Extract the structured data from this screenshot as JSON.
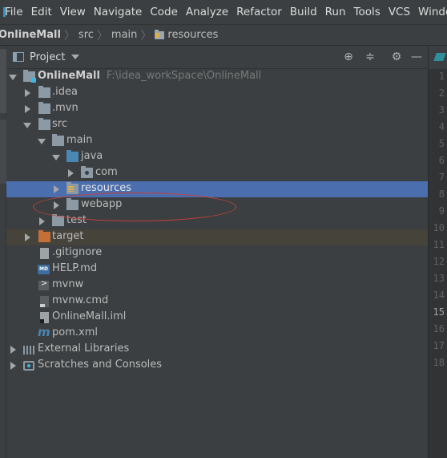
{
  "menubar": {
    "items": [
      "File",
      "Edit",
      "View",
      "Navigate",
      "Code",
      "Analyze",
      "Refactor",
      "Build",
      "Run",
      "Tools",
      "VCS",
      "Window"
    ]
  },
  "breadcrumb": {
    "project": "OnlineMall",
    "parts": [
      "src",
      "main",
      "resources"
    ]
  },
  "project_panel": {
    "title": "Project",
    "tree": [
      {
        "label": "OnlineMall",
        "path": "F:\\idea_workSpace\\OnlineMall"
      },
      {
        "label": ".idea"
      },
      {
        "label": ".mvn"
      },
      {
        "label": "src"
      },
      {
        "label": "main"
      },
      {
        "label": "java"
      },
      {
        "label": "com"
      },
      {
        "label": "resources"
      },
      {
        "label": "webapp"
      },
      {
        "label": "test"
      },
      {
        "label": "target"
      },
      {
        "label": ".gitignore"
      },
      {
        "label": "HELP.md"
      },
      {
        "label": "mvnw"
      },
      {
        "label": "mvnw.cmd"
      },
      {
        "label": "OnlineMall.iml"
      },
      {
        "label": "pom.xml"
      },
      {
        "label": "External Libraries"
      },
      {
        "label": "Scratches and Consoles"
      }
    ]
  },
  "editor": {
    "line_numbers": [
      "1",
      "2",
      "3",
      "4",
      "5",
      "6",
      "7",
      "8",
      "9",
      "10",
      "11",
      "12",
      "13",
      "14",
      "15",
      "16",
      "17",
      "18"
    ],
    "current_line": "15"
  },
  "colors": {
    "selection": "#4b6eaf",
    "annotation": "#c8403a",
    "excluded_folder": "#c46f3a"
  }
}
